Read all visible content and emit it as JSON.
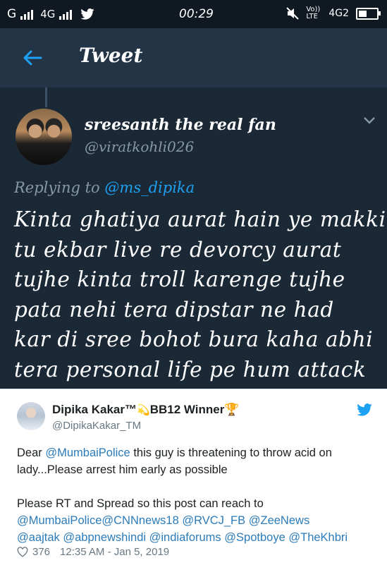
{
  "status_bar": {
    "carrier_left": "G",
    "network_2": "4G",
    "time": "00:29",
    "volte": "Vo)) LTE",
    "network_right": "4G2"
  },
  "header": {
    "title": "Tweet"
  },
  "tweet": {
    "display_name": "sreesanth the real fan",
    "handle": "@viratkohli026",
    "replying_prefix": "Replying to",
    "replying_to": "@ms_dipika",
    "lines": [
      "Kinta ghatiya aurat hain ye makki",
      "tu ekbar live re devorcy aurat",
      "tujhe kinta troll karenge tujhe",
      "pata nehi tera dipstar ne had",
      "kar di sree bohot bura kaha abhi",
      "tera personal life pe hum attack"
    ]
  },
  "embed": {
    "name": "Dipika Kakar™",
    "name_suffix": "BB12 Winner",
    "handle": "@DipikaKakar_TM",
    "p1_a": "Dear ",
    "p1_mention": "@MumbaiPolice",
    "p1_b": " this guy is threatening to throw acid on lady...Please arrest him early as possible",
    "p2_text": "Please RT and Spread so this post can reach to",
    "mentions": [
      "@MumbaiPolice",
      "@CNNnews18",
      "@RVCJ_FB",
      "@ZeeNews",
      "@aajtak",
      "@abpnewshindi",
      "@indiaforums",
      "@Spotboye",
      "@TheKhbri"
    ],
    "likes": "376",
    "timestamp": "12:35 AM - Jan 5, 2019"
  },
  "colors": {
    "background_dark": "#1b2836",
    "appbar": "#243447",
    "accent": "#1da1f2",
    "link": "#2b7bb9"
  },
  "icons": [
    "back-arrow-icon",
    "signal-icon",
    "twitter-bird-icon",
    "mute-icon",
    "battery-icon",
    "chevron-down-icon",
    "heart-icon",
    "shooting-star-icon",
    "trophy-icon"
  ]
}
